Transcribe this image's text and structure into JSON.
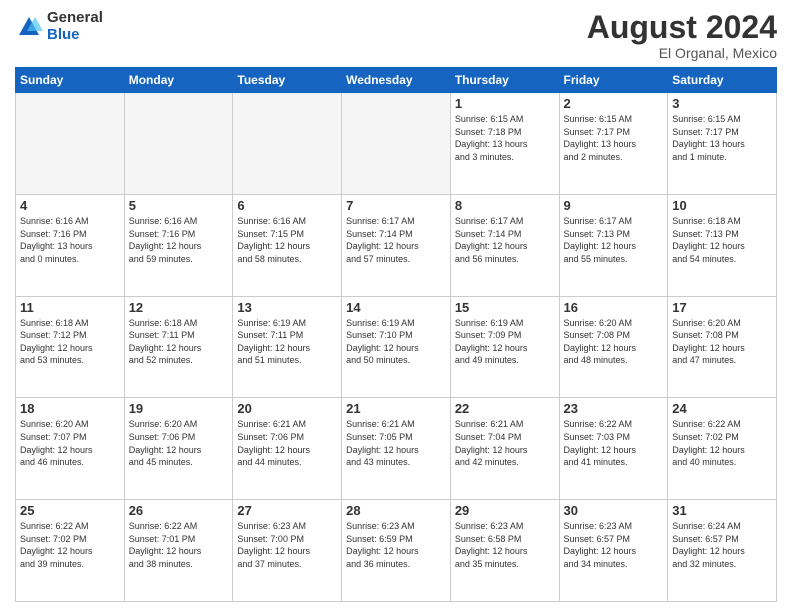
{
  "logo": {
    "general": "General",
    "blue": "Blue"
  },
  "header": {
    "month_year": "August 2024",
    "location": "El Organal, Mexico"
  },
  "days_of_week": [
    "Sunday",
    "Monday",
    "Tuesday",
    "Wednesday",
    "Thursday",
    "Friday",
    "Saturday"
  ],
  "weeks": [
    [
      {
        "day": "",
        "info": "",
        "empty": true
      },
      {
        "day": "",
        "info": "",
        "empty": true
      },
      {
        "day": "",
        "info": "",
        "empty": true
      },
      {
        "day": "",
        "info": "",
        "empty": true
      },
      {
        "day": "1",
        "info": "Sunrise: 6:15 AM\nSunset: 7:18 PM\nDaylight: 13 hours\nand 3 minutes."
      },
      {
        "day": "2",
        "info": "Sunrise: 6:15 AM\nSunset: 7:17 PM\nDaylight: 13 hours\nand 2 minutes."
      },
      {
        "day": "3",
        "info": "Sunrise: 6:15 AM\nSunset: 7:17 PM\nDaylight: 13 hours\nand 1 minute."
      }
    ],
    [
      {
        "day": "4",
        "info": "Sunrise: 6:16 AM\nSunset: 7:16 PM\nDaylight: 13 hours\nand 0 minutes."
      },
      {
        "day": "5",
        "info": "Sunrise: 6:16 AM\nSunset: 7:16 PM\nDaylight: 12 hours\nand 59 minutes."
      },
      {
        "day": "6",
        "info": "Sunrise: 6:16 AM\nSunset: 7:15 PM\nDaylight: 12 hours\nand 58 minutes."
      },
      {
        "day": "7",
        "info": "Sunrise: 6:17 AM\nSunset: 7:14 PM\nDaylight: 12 hours\nand 57 minutes."
      },
      {
        "day": "8",
        "info": "Sunrise: 6:17 AM\nSunset: 7:14 PM\nDaylight: 12 hours\nand 56 minutes."
      },
      {
        "day": "9",
        "info": "Sunrise: 6:17 AM\nSunset: 7:13 PM\nDaylight: 12 hours\nand 55 minutes."
      },
      {
        "day": "10",
        "info": "Sunrise: 6:18 AM\nSunset: 7:13 PM\nDaylight: 12 hours\nand 54 minutes."
      }
    ],
    [
      {
        "day": "11",
        "info": "Sunrise: 6:18 AM\nSunset: 7:12 PM\nDaylight: 12 hours\nand 53 minutes."
      },
      {
        "day": "12",
        "info": "Sunrise: 6:18 AM\nSunset: 7:11 PM\nDaylight: 12 hours\nand 52 minutes."
      },
      {
        "day": "13",
        "info": "Sunrise: 6:19 AM\nSunset: 7:11 PM\nDaylight: 12 hours\nand 51 minutes."
      },
      {
        "day": "14",
        "info": "Sunrise: 6:19 AM\nSunset: 7:10 PM\nDaylight: 12 hours\nand 50 minutes."
      },
      {
        "day": "15",
        "info": "Sunrise: 6:19 AM\nSunset: 7:09 PM\nDaylight: 12 hours\nand 49 minutes."
      },
      {
        "day": "16",
        "info": "Sunrise: 6:20 AM\nSunset: 7:08 PM\nDaylight: 12 hours\nand 48 minutes."
      },
      {
        "day": "17",
        "info": "Sunrise: 6:20 AM\nSunset: 7:08 PM\nDaylight: 12 hours\nand 47 minutes."
      }
    ],
    [
      {
        "day": "18",
        "info": "Sunrise: 6:20 AM\nSunset: 7:07 PM\nDaylight: 12 hours\nand 46 minutes."
      },
      {
        "day": "19",
        "info": "Sunrise: 6:20 AM\nSunset: 7:06 PM\nDaylight: 12 hours\nand 45 minutes."
      },
      {
        "day": "20",
        "info": "Sunrise: 6:21 AM\nSunset: 7:06 PM\nDaylight: 12 hours\nand 44 minutes."
      },
      {
        "day": "21",
        "info": "Sunrise: 6:21 AM\nSunset: 7:05 PM\nDaylight: 12 hours\nand 43 minutes."
      },
      {
        "day": "22",
        "info": "Sunrise: 6:21 AM\nSunset: 7:04 PM\nDaylight: 12 hours\nand 42 minutes."
      },
      {
        "day": "23",
        "info": "Sunrise: 6:22 AM\nSunset: 7:03 PM\nDaylight: 12 hours\nand 41 minutes."
      },
      {
        "day": "24",
        "info": "Sunrise: 6:22 AM\nSunset: 7:02 PM\nDaylight: 12 hours\nand 40 minutes."
      }
    ],
    [
      {
        "day": "25",
        "info": "Sunrise: 6:22 AM\nSunset: 7:02 PM\nDaylight: 12 hours\nand 39 minutes."
      },
      {
        "day": "26",
        "info": "Sunrise: 6:22 AM\nSunset: 7:01 PM\nDaylight: 12 hours\nand 38 minutes."
      },
      {
        "day": "27",
        "info": "Sunrise: 6:23 AM\nSunset: 7:00 PM\nDaylight: 12 hours\nand 37 minutes."
      },
      {
        "day": "28",
        "info": "Sunrise: 6:23 AM\nSunset: 6:59 PM\nDaylight: 12 hours\nand 36 minutes."
      },
      {
        "day": "29",
        "info": "Sunrise: 6:23 AM\nSunset: 6:58 PM\nDaylight: 12 hours\nand 35 minutes."
      },
      {
        "day": "30",
        "info": "Sunrise: 6:23 AM\nSunset: 6:57 PM\nDaylight: 12 hours\nand 34 minutes."
      },
      {
        "day": "31",
        "info": "Sunrise: 6:24 AM\nSunset: 6:57 PM\nDaylight: 12 hours\nand 32 minutes."
      }
    ]
  ]
}
